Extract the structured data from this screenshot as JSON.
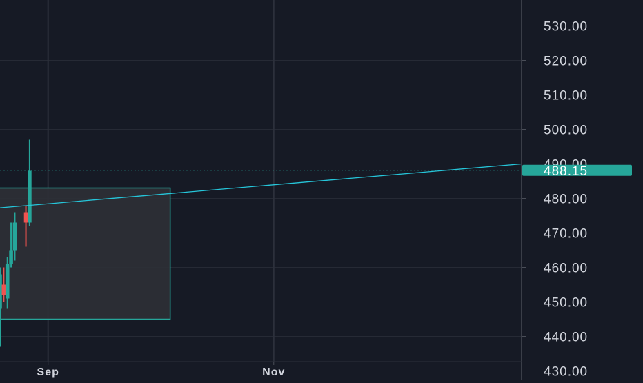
{
  "chart_data": {
    "type": "candlestick",
    "y_ticks": [
      "530.00",
      "520.00",
      "510.00",
      "500.00",
      "490.00",
      "480.00",
      "470.00",
      "460.00",
      "450.00",
      "440.00",
      "430.00"
    ],
    "x_ticks": [
      {
        "label": "Sep",
        "date": "2024-09-01"
      },
      {
        "label": "Nov",
        "date": "2024-11-01"
      }
    ],
    "ylim": [
      427.5,
      537.5
    ],
    "x_range": [
      "2024-08-19",
      "2025-01-07"
    ],
    "current_price": {
      "value": 488.15,
      "label": "488.15"
    },
    "candles": [
      {
        "date": "2024-08-19",
        "open": 448,
        "high": 460,
        "low": 437,
        "close": 458
      },
      {
        "date": "2024-08-20",
        "open": 455,
        "high": 460,
        "low": 450,
        "close": 452
      },
      {
        "date": "2024-08-21",
        "open": 451,
        "high": 463,
        "low": 448,
        "close": 461
      },
      {
        "date": "2024-08-22",
        "open": 461,
        "high": 473,
        "low": 460,
        "close": 465
      },
      {
        "date": "2024-08-23",
        "open": 465,
        "high": 476,
        "low": 462,
        "close": 473
      },
      {
        "date": "2024-08-26",
        "open": 476,
        "high": 478,
        "low": 466,
        "close": 473
      },
      {
        "date": "2024-08-27",
        "open": 473,
        "high": 497,
        "low": 472,
        "close": 488
      }
    ],
    "box": {
      "start": "2024-08-16",
      "end": "2024-10-04",
      "top": 483,
      "bottom": 445
    },
    "trend_line": {
      "start_date": "2024-08-16",
      "start_value": 477,
      "end_date": "2025-01-07",
      "end_value": 490
    },
    "colors": {
      "background": "#161a25",
      "grid": "#262a35",
      "axis_text": "#d1d4dc",
      "up": "#26a69a",
      "down": "#ef5350",
      "box_fill": "#2e3036",
      "box_stroke": "#26a69a",
      "trend": "#26c6da",
      "price_tag": "#26a69a"
    }
  }
}
